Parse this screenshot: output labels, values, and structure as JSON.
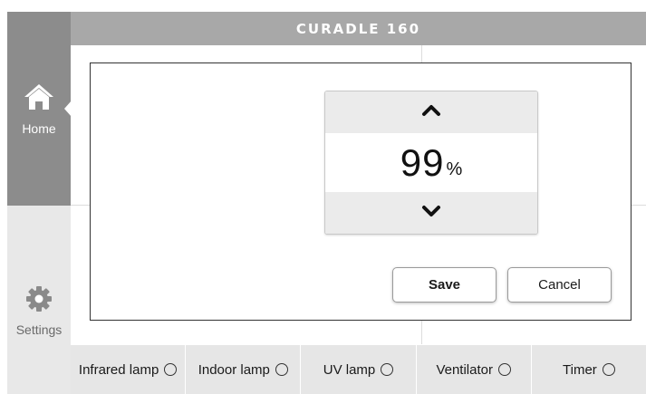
{
  "app": {
    "title": "CURADLE 160"
  },
  "sidebar": {
    "items": [
      {
        "label": "Home",
        "icon": "home-icon",
        "active": true
      },
      {
        "label": "Settings",
        "icon": "gear-icon",
        "active": false
      }
    ]
  },
  "dialog": {
    "stepper": {
      "value": "99",
      "unit": "%",
      "up_icon": "chevron-up-icon",
      "down_icon": "chevron-down-icon"
    },
    "save_label": "Save",
    "cancel_label": "Cancel"
  },
  "bottom_bar": {
    "items": [
      {
        "label": "Infrared lamp",
        "selected": false
      },
      {
        "label": "Indoor lamp",
        "selected": false
      },
      {
        "label": "UV lamp",
        "selected": false
      },
      {
        "label": "Ventilator",
        "selected": false
      },
      {
        "label": "Timer",
        "selected": false
      }
    ]
  },
  "colors": {
    "header_bg": "#a8a8a8",
    "sidebar_active_bg": "#8c8c8c",
    "sidebar_bg": "#e8e8e8",
    "stepper_button_bg": "#ebebeb",
    "bottom_bar_bg": "#e6e6e6"
  }
}
